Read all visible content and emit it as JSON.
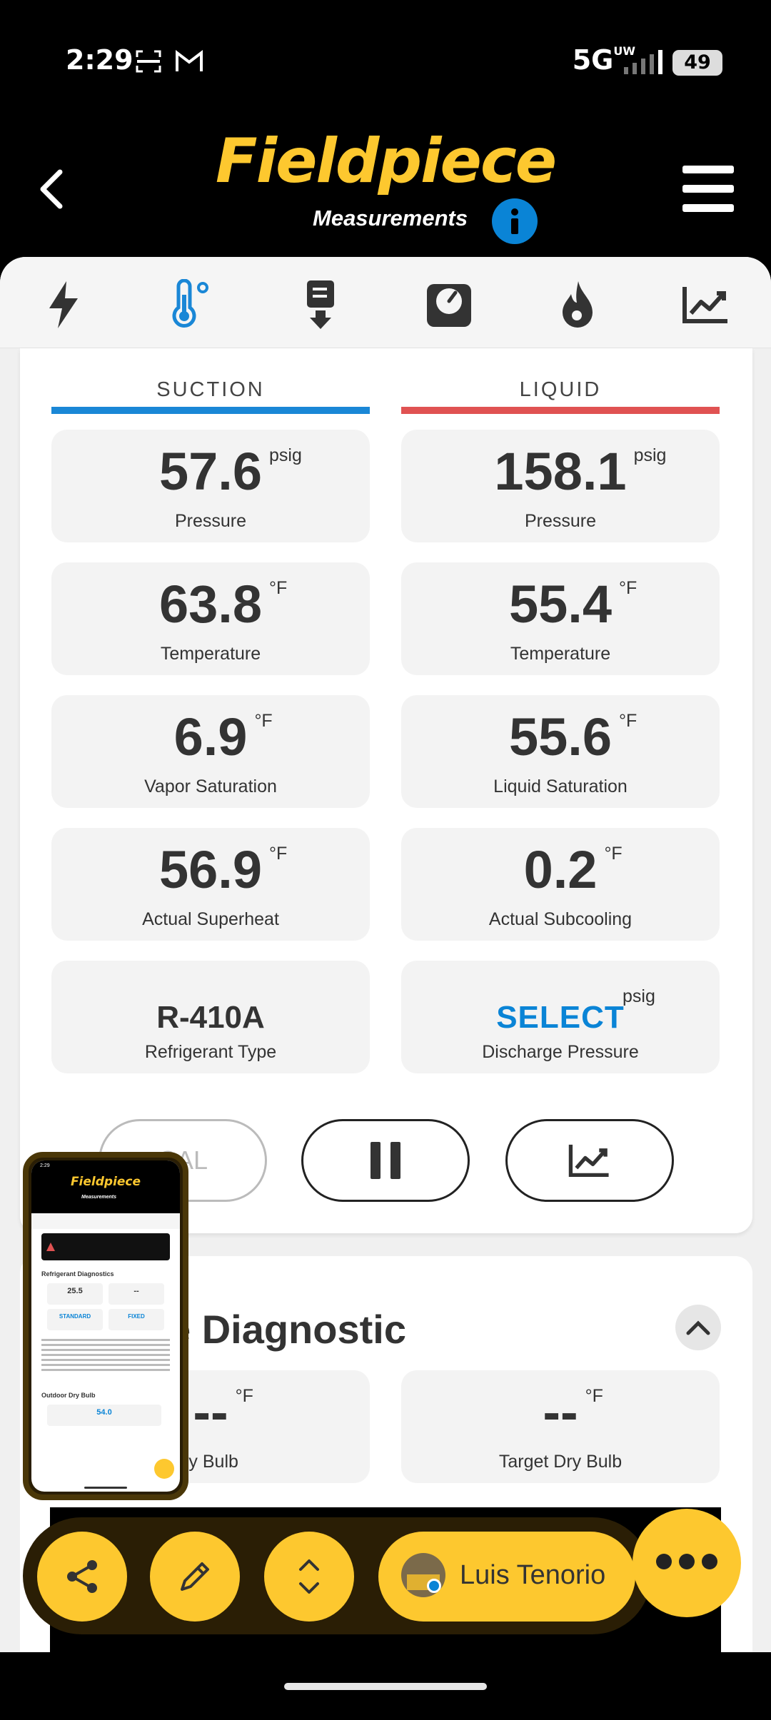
{
  "status_bar": {
    "time": "2:29",
    "network": "5G",
    "network_super": "UW",
    "battery": "49"
  },
  "header": {
    "logo": "Fieldpiece",
    "subtitle": "Measurements"
  },
  "toolbar": {
    "icons": [
      "lightning-icon",
      "thermometer-icon",
      "vacuum-icon",
      "gauge-icon",
      "flame-icon",
      "trend-chart-icon"
    ],
    "active_index": 1
  },
  "columns": {
    "suction": {
      "heading": "SUCTION",
      "color": "#1a87d6"
    },
    "liquid": {
      "heading": "LIQUID",
      "color": "#e05252"
    }
  },
  "tiles": {
    "suction_pressure": {
      "value": "57.6",
      "unit": "psig",
      "label": "Pressure"
    },
    "liquid_pressure": {
      "value": "158.1",
      "unit": "psig",
      "label": "Pressure"
    },
    "suction_temperature": {
      "value": "63.8",
      "unit": "°F",
      "label": "Temperature"
    },
    "liquid_temperature": {
      "value": "55.4",
      "unit": "°F",
      "label": "Temperature"
    },
    "vapor_saturation": {
      "value": "6.9",
      "unit": "°F",
      "label": "Vapor Saturation"
    },
    "liquid_saturation": {
      "value": "55.6",
      "unit": "°F",
      "label": "Liquid Saturation"
    },
    "actual_superheat": {
      "value": "56.9",
      "unit": "°F",
      "label": "Actual Superheat"
    },
    "actual_subcooling": {
      "value": "0.2",
      "unit": "°F",
      "label": "Actual Subcooling"
    },
    "refrigerant_type": {
      "value": "R-410A",
      "label": "Refrigerant Type"
    },
    "discharge_pressure": {
      "value": "SELECT",
      "unit": "psig",
      "label": "Discharge Pressure"
    }
  },
  "actions": {
    "cal_label": "CAL"
  },
  "diagnostic": {
    "title": "e Diagnostic",
    "dry_bulb": {
      "value": "--",
      "unit": "°F",
      "label": "ry Bulb"
    },
    "target_dry_bulb": {
      "value": "--",
      "unit": "°F",
      "label": "Target Dry Bulb"
    }
  },
  "pip": {
    "time": "2:29",
    "logo": "Fieldpiece",
    "subtitle": "Measurements",
    "section1": "Refrigerant Diagnostics",
    "val1": "25.5",
    "val2": "--",
    "val3": "STANDARD",
    "val4": "FIXED",
    "section2": "Outdoor Dry Bulb",
    "val5": "54.0"
  },
  "bottom_bar": {
    "user_name": "Luis Tenorio"
  },
  "colors": {
    "brand_yellow": "#fdc82f",
    "accent_blue": "#0a84d6",
    "dark_bar": "#2a1e05"
  }
}
